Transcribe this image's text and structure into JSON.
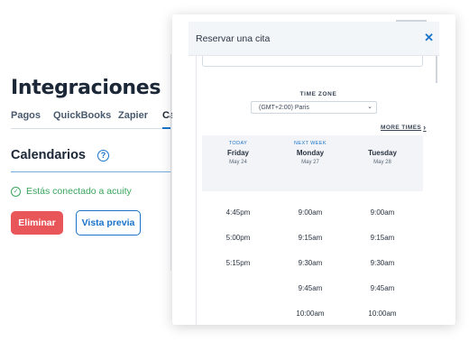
{
  "page": {
    "title": "Integraciones",
    "tabs": [
      "Pagos",
      "QuickBooks",
      "Zapier",
      "Cal"
    ],
    "section_title": "Calendarios",
    "connected_text": "Estás conectado a acuity",
    "delete_label": "Eliminar",
    "preview_label": "Vista previa"
  },
  "modal": {
    "title": "Reservar una cita",
    "close_glyph": "✕",
    "timezone_label": "TIME ZONE",
    "timezone_value": "(GMT+2:00) Paris",
    "more_times_label": "MORE TIMES",
    "days": [
      {
        "tag": "TODAY",
        "name": "Friday",
        "date": "May 24"
      },
      {
        "tag": "NEXT WEEK",
        "name": "Monday",
        "date": "May 27"
      },
      {
        "tag": "",
        "name": "Tuesday",
        "date": "May 28"
      }
    ],
    "times": [
      [
        "4:45pm",
        "5:00pm",
        "5:15pm"
      ],
      [
        "9:00am",
        "9:15am",
        "9:30am",
        "9:45am",
        "10:00am"
      ],
      [
        "9:00am",
        "9:15am",
        "9:30am",
        "9:45am",
        "10:00am"
      ]
    ]
  },
  "colors": {
    "accent": "#1a73c9",
    "danger": "#e8565a",
    "success": "#3aa55c"
  }
}
